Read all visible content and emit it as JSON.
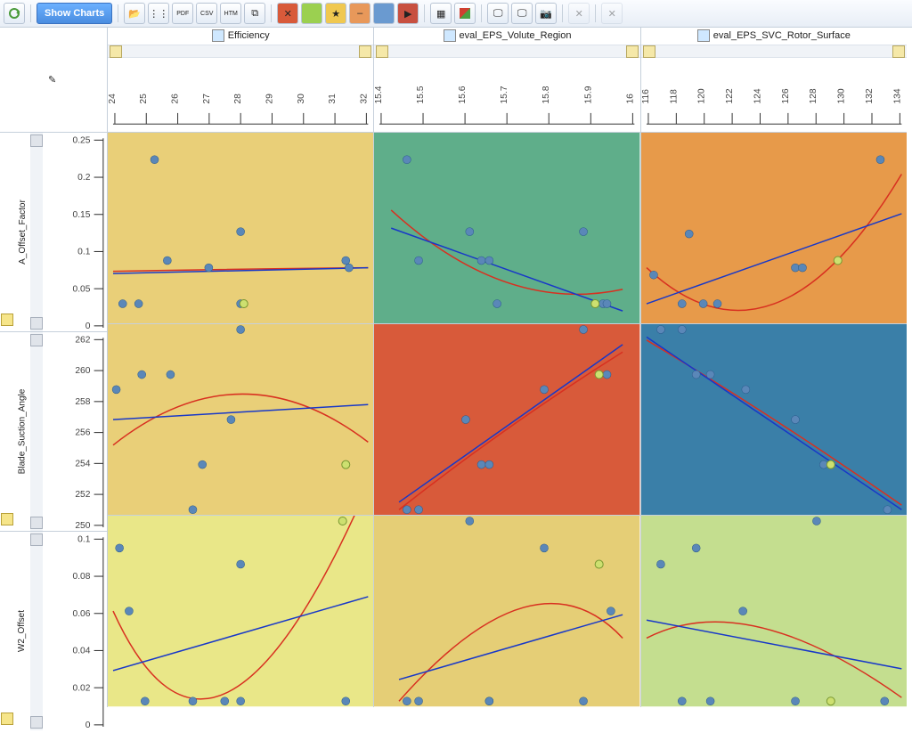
{
  "toolbar": {
    "refresh_icon": "refresh",
    "show_charts": "Show Charts",
    "icons": [
      "folder-open-icon",
      "scatter-icon",
      "pdf-export-icon",
      "csv-export-icon",
      "htm-export-icon",
      "copy-icon",
      "flag-red-icon",
      "flag-green-icon",
      "star-icon",
      "minus-icon",
      "tag-blue-icon",
      "tag-red-icon",
      "grid-icon",
      "overlay-icon",
      "screen1-icon",
      "screen2-icon",
      "camera-icon",
      "close1-icon",
      "close2-icon"
    ]
  },
  "cols": [
    {
      "label": "Efficiency",
      "ticks": [
        24,
        25,
        26,
        27,
        28,
        29,
        30,
        31,
        32
      ]
    },
    {
      "label": "eval_EPS_Volute_Region",
      "ticks": [
        15.4,
        15.5,
        15.6,
        15.7,
        15.8,
        15.9,
        16
      ]
    },
    {
      "label": "eval_EPS_SVC_Rotor_Surface",
      "ticks": [
        116,
        118,
        120,
        122,
        124,
        126,
        128,
        130,
        132,
        134
      ]
    }
  ],
  "rows": [
    {
      "label": "A_Offset_Factor",
      "ticks": [
        0,
        0.05,
        0.1,
        0.15,
        0.2,
        0.25
      ]
    },
    {
      "label": "Blade_Suction_Angle",
      "ticks": [
        250,
        252,
        254,
        256,
        258,
        260,
        262
      ]
    },
    {
      "label": "W2_Offset",
      "ticks": [
        0,
        0.02,
        0.04,
        0.06,
        0.08,
        0.1
      ]
    }
  ],
  "cells": [
    {
      "bg": "#e9cf78"
    },
    {
      "bg": "#5fae8a"
    },
    {
      "bg": "#e79a4a"
    },
    {
      "bg": "#e9cf78"
    },
    {
      "bg": "#d85a3a"
    },
    {
      "bg": "#3a7fa8"
    },
    {
      "bg": "#e9e788"
    },
    {
      "bg": "#e5ce76"
    },
    {
      "bg": "#c4de8f"
    }
  ],
  "chart_data": {
    "type": "scatter",
    "layout": "matrix",
    "x_vars": [
      "Efficiency",
      "eval_EPS_Volute_Region",
      "eval_EPS_SVC_Rotor_Surface"
    ],
    "y_vars": [
      "A_Offset_Factor",
      "Blade_Suction_Angle",
      "W2_Offset"
    ],
    "x_ranges": {
      "Efficiency": [
        24,
        32
      ],
      "eval_EPS_Volute_Region": [
        15.4,
        16.05
      ],
      "eval_EPS_SVC_Rotor_Surface": [
        116,
        134
      ]
    },
    "y_ranges": {
      "A_Offset_Factor": [
        0,
        0.25
      ],
      "Blade_Suction_Angle": [
        250,
        262
      ],
      "W2_Offset": [
        0,
        0.1
      ]
    },
    "series": [
      {
        "x_var": "Efficiency",
        "y_var": "A_Offset_Factor",
        "points": [
          [
            24.3,
            0.02
          ],
          [
            24.8,
            0.02
          ],
          [
            25.3,
            0.22
          ],
          [
            25.7,
            0.08
          ],
          [
            27.0,
            0.07
          ],
          [
            28.0,
            0.12
          ],
          [
            28.0,
            0.02
          ],
          [
            28.1,
            0.02
          ],
          [
            31.3,
            0.08
          ],
          [
            31.4,
            0.07
          ]
        ],
        "linear": [
          [
            24,
            0.062
          ],
          [
            32,
            0.07
          ]
        ],
        "quad": [
          [
            24,
            0.065
          ],
          [
            28,
            0.068
          ],
          [
            32,
            0.07
          ]
        ]
      },
      {
        "x_var": "eval_EPS_Volute_Region",
        "y_var": "A_Offset_Factor",
        "points": [
          [
            15.47,
            0.22
          ],
          [
            15.5,
            0.08
          ],
          [
            15.63,
            0.12
          ],
          [
            15.66,
            0.08
          ],
          [
            15.68,
            0.08
          ],
          [
            15.7,
            0.02
          ],
          [
            15.92,
            0.12
          ],
          [
            15.95,
            0.02
          ],
          [
            15.97,
            0.02
          ],
          [
            15.98,
            0.02
          ]
        ],
        "linear": [
          [
            15.43,
            0.125
          ],
          [
            16.02,
            0.01
          ]
        ],
        "quad": [
          [
            15.43,
            0.15
          ],
          [
            15.72,
            0.05
          ],
          [
            16.02,
            0.04
          ]
        ]
      },
      {
        "x_var": "eval_EPS_SVC_Rotor_Surface",
        "y_var": "A_Offset_Factor",
        "points": [
          [
            116.5,
            0.06
          ],
          [
            118.5,
            0.02
          ],
          [
            119.0,
            0.117
          ],
          [
            120.0,
            0.02
          ],
          [
            121.0,
            0.02
          ],
          [
            126.5,
            0.07
          ],
          [
            127.0,
            0.07
          ],
          [
            129.5,
            0.08
          ],
          [
            132.5,
            0.22
          ]
        ],
        "linear": [
          [
            116,
            0.02
          ],
          [
            134,
            0.145
          ]
        ],
        "quad": [
          [
            116,
            0.07
          ],
          [
            125,
            0.02
          ],
          [
            134,
            0.2
          ]
        ]
      },
      {
        "x_var": "Efficiency",
        "y_var": "Blade_Suction_Angle",
        "points": [
          [
            24.1,
            258
          ],
          [
            24.9,
            259
          ],
          [
            25.8,
            259
          ],
          [
            26.5,
            250
          ],
          [
            26.8,
            253
          ],
          [
            27.7,
            256
          ],
          [
            28.0,
            262
          ],
          [
            31.3,
            253
          ],
          [
            31.3,
            253
          ]
        ],
        "linear": [
          [
            24,
            256
          ],
          [
            32,
            257
          ]
        ],
        "quad": [
          [
            24,
            254.3
          ],
          [
            28,
            257.7
          ],
          [
            32,
            254.5
          ]
        ]
      },
      {
        "x_var": "eval_EPS_Volute_Region",
        "y_var": "Blade_Suction_Angle",
        "points": [
          [
            15.47,
            250
          ],
          [
            15.5,
            250
          ],
          [
            15.62,
            256
          ],
          [
            15.66,
            253
          ],
          [
            15.68,
            253
          ],
          [
            15.82,
            258
          ],
          [
            15.92,
            262
          ],
          [
            15.96,
            259
          ],
          [
            15.98,
            259
          ]
        ],
        "linear": [
          [
            15.45,
            250.5
          ],
          [
            16.02,
            261
          ]
        ],
        "quad": [
          [
            15.45,
            250
          ],
          [
            15.73,
            255.5
          ],
          [
            16.02,
            260.5
          ]
        ]
      },
      {
        "x_var": "eval_EPS_SVC_Rotor_Surface",
        "y_var": "Blade_Suction_Angle",
        "points": [
          [
            117,
            262
          ],
          [
            118.5,
            262
          ],
          [
            119.5,
            259
          ],
          [
            120.5,
            259
          ],
          [
            123,
            258
          ],
          [
            126.5,
            256
          ],
          [
            128.5,
            253
          ],
          [
            129,
            253
          ],
          [
            133,
            250
          ]
        ],
        "linear": [
          [
            116,
            261.5
          ],
          [
            134,
            250
          ]
        ],
        "quad": [
          [
            116,
            261.3
          ],
          [
            125,
            256
          ],
          [
            134,
            250.3
          ]
        ]
      },
      {
        "x_var": "Efficiency",
        "y_var": "W2_Offset",
        "points": [
          [
            24.2,
            0.085
          ],
          [
            24.5,
            0.05
          ],
          [
            25.0,
            0.0
          ],
          [
            26.5,
            0.0
          ],
          [
            27.5,
            0.0
          ],
          [
            28.0,
            0.0
          ],
          [
            28.0,
            0.076
          ],
          [
            31.2,
            0.1
          ],
          [
            31.3,
            0.0
          ]
        ],
        "linear": [
          [
            24,
            0.017
          ],
          [
            32,
            0.058
          ]
        ],
        "quad": [
          [
            24,
            0.05
          ],
          [
            27.2,
            0.005
          ],
          [
            32,
            0.12
          ]
        ]
      },
      {
        "x_var": "eval_EPS_Volute_Region",
        "y_var": "W2_Offset",
        "points": [
          [
            15.47,
            0.0
          ],
          [
            15.5,
            0.0
          ],
          [
            15.63,
            0.1
          ],
          [
            15.68,
            0.0
          ],
          [
            15.68,
            0.0
          ],
          [
            15.82,
            0.085
          ],
          [
            15.92,
            0.0
          ],
          [
            15.96,
            0.076
          ],
          [
            15.99,
            0.05
          ]
        ],
        "linear": [
          [
            15.45,
            0.012
          ],
          [
            16.02,
            0.048
          ]
        ],
        "quad": [
          [
            15.45,
            0.0
          ],
          [
            15.8,
            0.052
          ],
          [
            16.02,
            0.035
          ]
        ]
      },
      {
        "x_var": "eval_EPS_SVC_Rotor_Surface",
        "y_var": "W2_Offset",
        "points": [
          [
            117,
            0.076
          ],
          [
            118.5,
            0.0
          ],
          [
            119.5,
            0.085
          ],
          [
            120.5,
            0.0
          ],
          [
            122.8,
            0.05
          ],
          [
            126.5,
            0.0
          ],
          [
            128.0,
            0.1
          ],
          [
            129,
            0.0
          ],
          [
            132.8,
            0.0
          ]
        ],
        "linear": [
          [
            116,
            0.045
          ],
          [
            134,
            0.018
          ]
        ],
        "quad": [
          [
            116,
            0.035
          ],
          [
            123,
            0.041
          ],
          [
            134,
            0.002
          ]
        ]
      }
    ]
  }
}
